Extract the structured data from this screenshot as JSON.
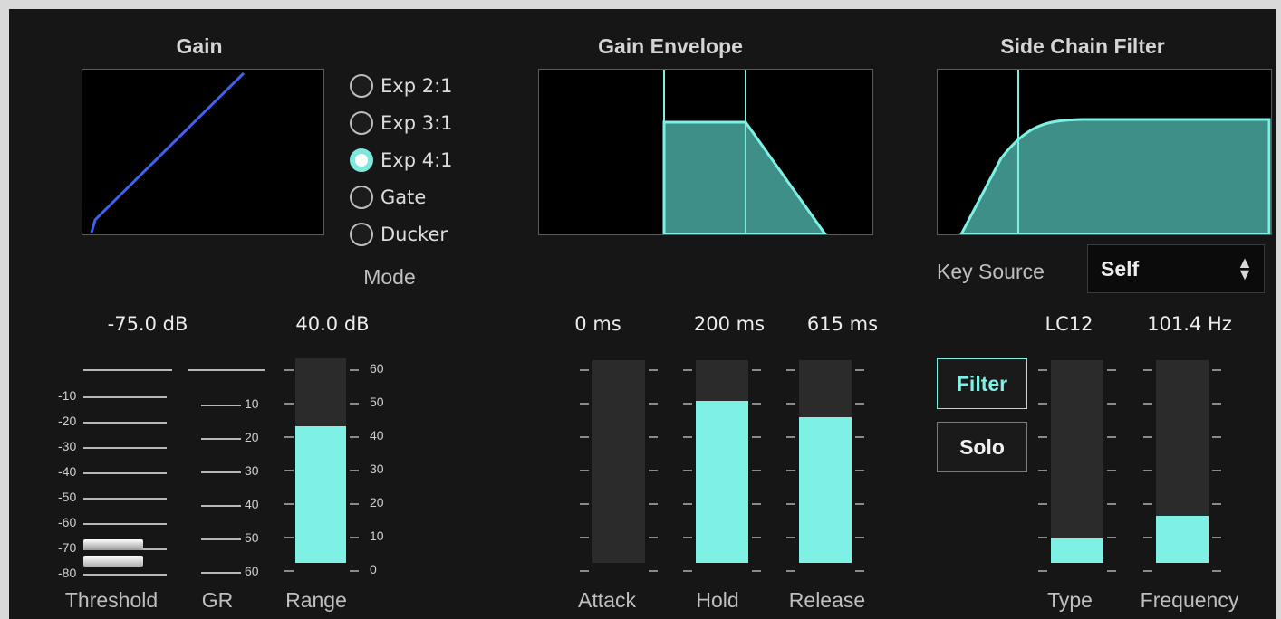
{
  "gain": {
    "title": "Gain",
    "mode_label": "Mode",
    "modes": [
      {
        "label": "Exp 2:1",
        "selected": false
      },
      {
        "label": "Exp 3:1",
        "selected": false
      },
      {
        "label": "Exp 4:1",
        "selected": true
      },
      {
        "label": "Gate",
        "selected": false
      },
      {
        "label": "Ducker",
        "selected": false
      }
    ],
    "threshold_value": "-75.0 dB",
    "range_value": "40.0 dB",
    "threshold_label": "Threshold",
    "gr_label": "GR",
    "range_label": "Range",
    "threshold_scale": [
      "-10",
      "-20",
      "-30",
      "-40",
      "-50",
      "-60",
      "-70",
      "-80"
    ],
    "gr_scale": [
      "10",
      "20",
      "30",
      "40",
      "50",
      "60"
    ],
    "range_scale": [
      "60",
      "50",
      "40",
      "30",
      "20",
      "10",
      "0"
    ],
    "range_level": 0.667,
    "curve_color": "#3f63f0"
  },
  "envelope": {
    "title": "Gain Envelope",
    "attack_value": "0 ms",
    "hold_value": "200 ms",
    "release_value": "615 ms",
    "attack_label": "Attack",
    "hold_label": "Hold",
    "release_label": "Release",
    "attack_level": 0.0,
    "hold_level": 0.8,
    "release_level": 0.72
  },
  "sidechain": {
    "title": "Side Chain Filter",
    "key_source_label": "Key Source",
    "key_source_value": "Self",
    "filter_button": "Filter",
    "solo_button": "Solo",
    "filter_on": true,
    "type_value": "LC12",
    "frequency_value": "101.4 Hz",
    "type_label": "Type",
    "frequency_label": "Frequency",
    "type_level": 0.12,
    "frequency_level": 0.23
  },
  "colors": {
    "accent": "#7ff0e4",
    "panel": "#161616",
    "frame": "#d9d9d9"
  }
}
